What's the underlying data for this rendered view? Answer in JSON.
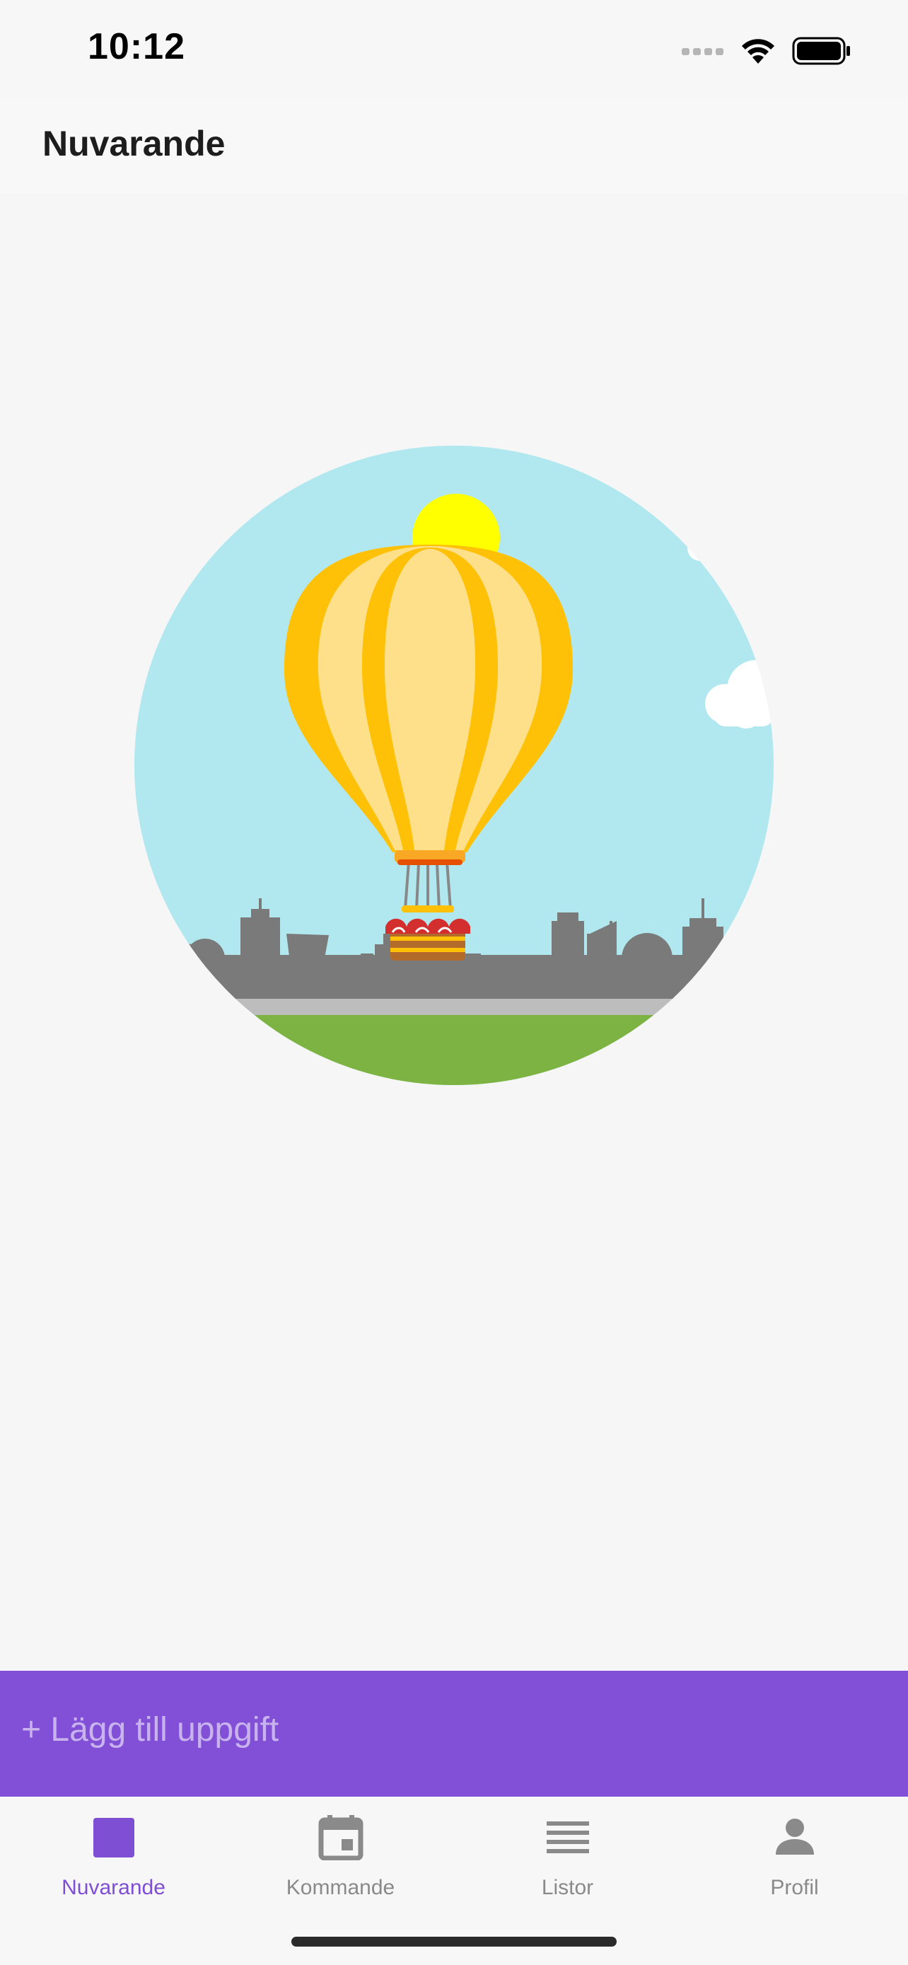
{
  "status_bar": {
    "time": "10:12",
    "icons": [
      "cellular-signal-icon",
      "wifi-icon",
      "battery-icon"
    ]
  },
  "header": {
    "title": "Nuvarande"
  },
  "main": {
    "illustration": "hot-air-balloon-city-illustration"
  },
  "add_task": {
    "label": "+ Lägg till uppgift"
  },
  "tab_bar": {
    "tabs": [
      {
        "label": "Nuvarande",
        "icon": "square-icon",
        "active": true
      },
      {
        "label": "Kommande",
        "icon": "calendar-icon",
        "active": false
      },
      {
        "label": "Listor",
        "icon": "list-icon",
        "active": false
      },
      {
        "label": "Profil",
        "icon": "person-icon",
        "active": false
      }
    ]
  },
  "colors": {
    "accent": "#8250d6",
    "tab_active": "#7e4fd3",
    "tab_inactive": "#8a8a8a",
    "background": "#f6f6f6"
  }
}
